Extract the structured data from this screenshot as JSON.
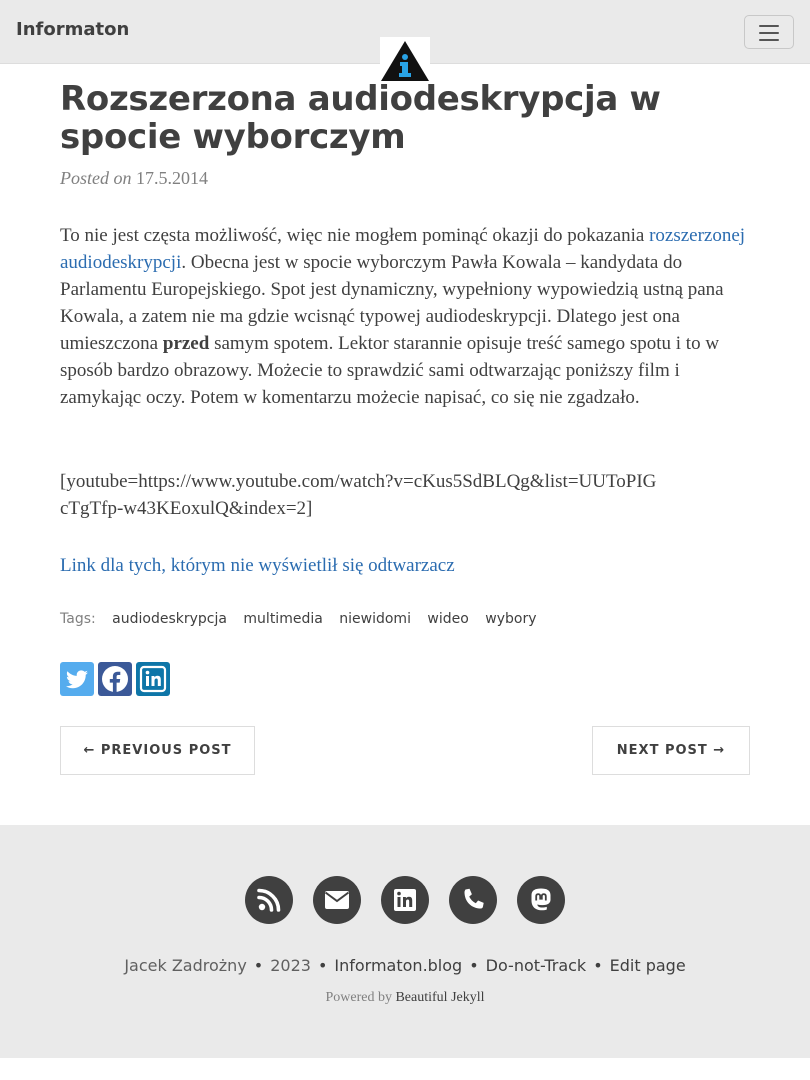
{
  "navbar": {
    "brand": "Informaton",
    "menu_icon": "hamburger-icon",
    "logo_icon": "informaton-logo-icon"
  },
  "post": {
    "title": "Rozszerzona audiodeskrypcja w spocie wyborczym",
    "meta_prefix": "Posted on ",
    "date": "17.5.2014",
    "p1_a": "To nie jest częsta możliwość, więc nie mogłem pominąć okazji do pokazania ",
    "p1_link": "rozszerzonej audiodeskrypcji",
    "p1_b": ". Obecna jest w spocie wyborczym Pawła Kowala – kandydata do Parlamentu Europejskiego. Spot jest dynamiczny, wypełniony wypowiedzią ustną pana Kowala, a zatem nie ma gdzie wcisnąć typowej audiodeskrypcji. Dlatego jest ona umieszczona ",
    "p1_bold": "przed",
    "p1_c": " samym spotem. Lektor starannie opisuje treść samego spotu i to w sposób bardzo obrazowy. Możecie to sprawdzić sami odtwarzając poniższy film i zamykając oczy. Potem w komentarzu możecie napisać, co się nie zgadzało.",
    "p2": "[youtube=https://www.youtube.com/watch?v=cKus5SdBLQg&list=UUToPIGcTgTfp-w43KEoxulQ&index=2]",
    "p3_link": "Link dla tych, którym nie wyświetlił się odtwarzacz"
  },
  "tags": {
    "label": "Tags:",
    "items": [
      "audiodeskrypcja",
      "multimedia",
      "niewidomi",
      "wideo",
      "wybory"
    ]
  },
  "share": {
    "icons": [
      "twitter-icon",
      "facebook-icon",
      "linkedin-icon"
    ],
    "colors": {
      "twitter": "#55acee",
      "facebook": "#3b5998",
      "linkedin": "#0e76a8"
    }
  },
  "pager": {
    "prev": "← PREVIOUS POST",
    "next": "NEXT POST →"
  },
  "footer": {
    "icons": [
      "rss-icon",
      "envelope-icon",
      "linkedin-icon",
      "phone-icon",
      "mastodon-icon"
    ],
    "author": "Jacek Zadrożny",
    "year": "2023",
    "site": "Informaton.blog",
    "dnt": "Do-not-Track",
    "edit": "Edit page",
    "powered_prefix": "Powered by ",
    "powered_link": "Beautiful Jekyll"
  },
  "colors": {
    "link": "#2b6cb0",
    "navbar_bg": "#eaeaea",
    "text": "#404040"
  }
}
